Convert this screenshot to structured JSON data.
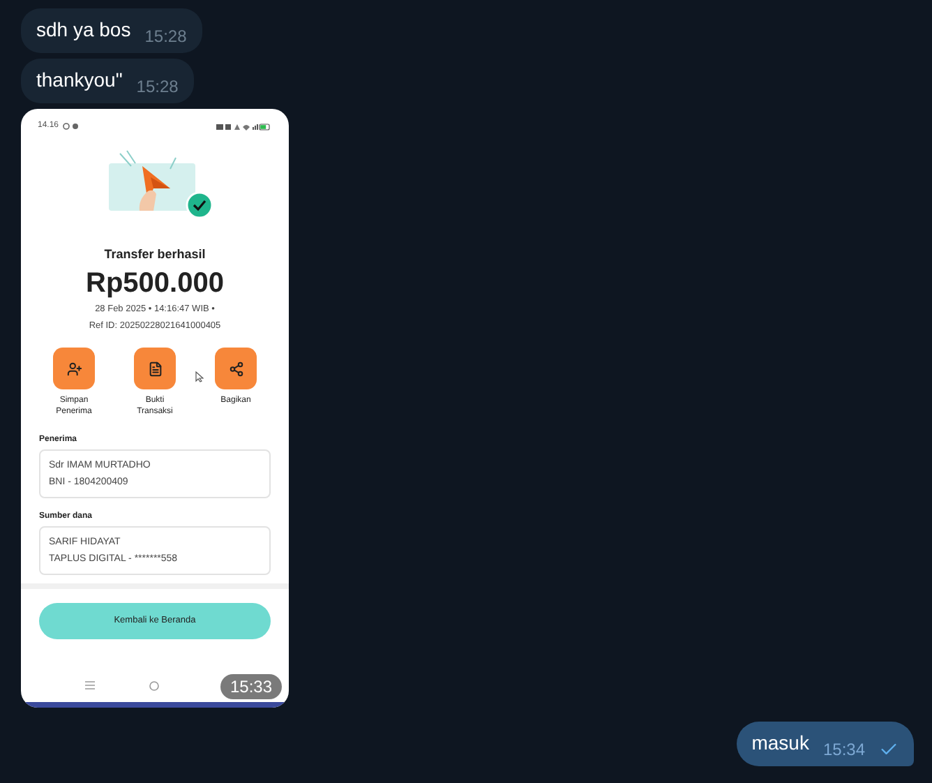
{
  "messages": [
    {
      "kind": "text",
      "outgoing": false,
      "text": "sdh ya bos",
      "time": "15:28"
    },
    {
      "kind": "text",
      "outgoing": false,
      "text": "thankyou\"",
      "time": "15:28"
    },
    {
      "kind": "image",
      "outgoing": false,
      "time": "15:33",
      "screen": {
        "status_time": "14.16",
        "title": "Transfer berhasil",
        "amount": "Rp500.000",
        "date_line": "28 Feb 2025 • 14:16:47 WIB •",
        "ref": "Ref ID: 20250228021641000405",
        "actions": [
          {
            "label": "Simpan Penerima"
          },
          {
            "label": "Bukti Transaksi"
          },
          {
            "label": "Bagikan"
          }
        ],
        "sections": [
          {
            "label": "Penerima",
            "lines": [
              "Sdr IMAM MURTADHO",
              "BNI - 1804200409"
            ]
          },
          {
            "label": "Sumber dana",
            "lines": [
              "SARIF HIDAYAT",
              "TAPLUS DIGITAL - *******558"
            ]
          }
        ],
        "button": "Kembali ke Beranda"
      }
    },
    {
      "kind": "text",
      "outgoing": true,
      "text": "masuk",
      "time": "15:34",
      "read": false
    }
  ]
}
